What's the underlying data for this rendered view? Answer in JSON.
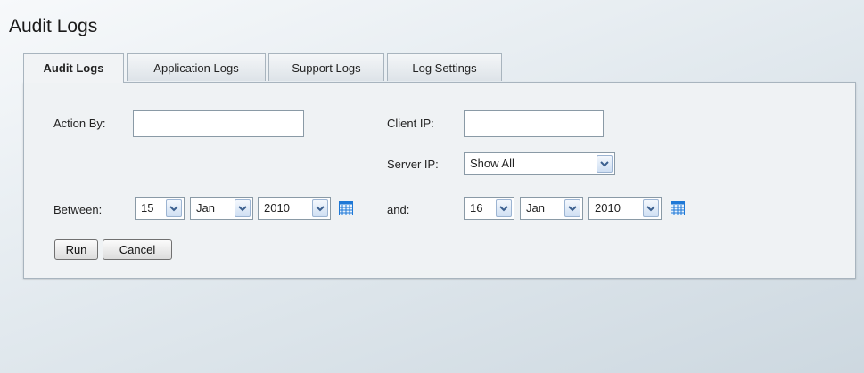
{
  "page_title": "Audit Logs",
  "tabs": [
    {
      "label": "Audit Logs"
    },
    {
      "label": "Application Logs"
    },
    {
      "label": "Support Logs"
    },
    {
      "label": "Log Settings"
    }
  ],
  "form": {
    "action_by_label": "Action By:",
    "action_by_value": "",
    "client_ip_label": "Client IP:",
    "client_ip_value": "",
    "server_ip_label": "Server IP:",
    "server_ip_value": "Show All",
    "between_label": "Between:",
    "from_day": "15",
    "from_month": "Jan",
    "from_year": "2010",
    "and_label": "and:",
    "to_day": "16",
    "to_month": "Jan",
    "to_year": "2010"
  },
  "buttons": {
    "run": "Run",
    "cancel": "Cancel"
  },
  "icons": {
    "calendar": "calendar-icon",
    "dropdown": "chevron-down-icon"
  },
  "colors": {
    "calendar_blue": "#1e78d6",
    "border": "#a8b4be"
  }
}
